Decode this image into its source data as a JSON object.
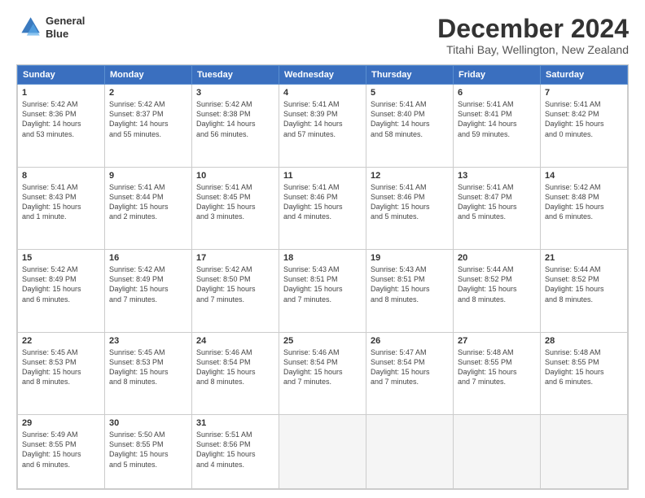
{
  "logo": {
    "line1": "General",
    "line2": "Blue"
  },
  "title": "December 2024",
  "subtitle": "Titahi Bay, Wellington, New Zealand",
  "days_of_week": [
    "Sunday",
    "Monday",
    "Tuesday",
    "Wednesday",
    "Thursday",
    "Friday",
    "Saturday"
  ],
  "weeks": [
    [
      {
        "day": "1",
        "info": "Sunrise: 5:42 AM\nSunset: 8:36 PM\nDaylight: 14 hours\nand 53 minutes."
      },
      {
        "day": "2",
        "info": "Sunrise: 5:42 AM\nSunset: 8:37 PM\nDaylight: 14 hours\nand 55 minutes."
      },
      {
        "day": "3",
        "info": "Sunrise: 5:42 AM\nSunset: 8:38 PM\nDaylight: 14 hours\nand 56 minutes."
      },
      {
        "day": "4",
        "info": "Sunrise: 5:41 AM\nSunset: 8:39 PM\nDaylight: 14 hours\nand 57 minutes."
      },
      {
        "day": "5",
        "info": "Sunrise: 5:41 AM\nSunset: 8:40 PM\nDaylight: 14 hours\nand 58 minutes."
      },
      {
        "day": "6",
        "info": "Sunrise: 5:41 AM\nSunset: 8:41 PM\nDaylight: 14 hours\nand 59 minutes."
      },
      {
        "day": "7",
        "info": "Sunrise: 5:41 AM\nSunset: 8:42 PM\nDaylight: 15 hours\nand 0 minutes."
      }
    ],
    [
      {
        "day": "8",
        "info": "Sunrise: 5:41 AM\nSunset: 8:43 PM\nDaylight: 15 hours\nand 1 minute."
      },
      {
        "day": "9",
        "info": "Sunrise: 5:41 AM\nSunset: 8:44 PM\nDaylight: 15 hours\nand 2 minutes."
      },
      {
        "day": "10",
        "info": "Sunrise: 5:41 AM\nSunset: 8:45 PM\nDaylight: 15 hours\nand 3 minutes."
      },
      {
        "day": "11",
        "info": "Sunrise: 5:41 AM\nSunset: 8:46 PM\nDaylight: 15 hours\nand 4 minutes."
      },
      {
        "day": "12",
        "info": "Sunrise: 5:41 AM\nSunset: 8:46 PM\nDaylight: 15 hours\nand 5 minutes."
      },
      {
        "day": "13",
        "info": "Sunrise: 5:41 AM\nSunset: 8:47 PM\nDaylight: 15 hours\nand 5 minutes."
      },
      {
        "day": "14",
        "info": "Sunrise: 5:42 AM\nSunset: 8:48 PM\nDaylight: 15 hours\nand 6 minutes."
      }
    ],
    [
      {
        "day": "15",
        "info": "Sunrise: 5:42 AM\nSunset: 8:49 PM\nDaylight: 15 hours\nand 6 minutes."
      },
      {
        "day": "16",
        "info": "Sunrise: 5:42 AM\nSunset: 8:49 PM\nDaylight: 15 hours\nand 7 minutes."
      },
      {
        "day": "17",
        "info": "Sunrise: 5:42 AM\nSunset: 8:50 PM\nDaylight: 15 hours\nand 7 minutes."
      },
      {
        "day": "18",
        "info": "Sunrise: 5:43 AM\nSunset: 8:51 PM\nDaylight: 15 hours\nand 7 minutes."
      },
      {
        "day": "19",
        "info": "Sunrise: 5:43 AM\nSunset: 8:51 PM\nDaylight: 15 hours\nand 8 minutes."
      },
      {
        "day": "20",
        "info": "Sunrise: 5:44 AM\nSunset: 8:52 PM\nDaylight: 15 hours\nand 8 minutes."
      },
      {
        "day": "21",
        "info": "Sunrise: 5:44 AM\nSunset: 8:52 PM\nDaylight: 15 hours\nand 8 minutes."
      }
    ],
    [
      {
        "day": "22",
        "info": "Sunrise: 5:45 AM\nSunset: 8:53 PM\nDaylight: 15 hours\nand 8 minutes."
      },
      {
        "day": "23",
        "info": "Sunrise: 5:45 AM\nSunset: 8:53 PM\nDaylight: 15 hours\nand 8 minutes."
      },
      {
        "day": "24",
        "info": "Sunrise: 5:46 AM\nSunset: 8:54 PM\nDaylight: 15 hours\nand 8 minutes."
      },
      {
        "day": "25",
        "info": "Sunrise: 5:46 AM\nSunset: 8:54 PM\nDaylight: 15 hours\nand 7 minutes."
      },
      {
        "day": "26",
        "info": "Sunrise: 5:47 AM\nSunset: 8:54 PM\nDaylight: 15 hours\nand 7 minutes."
      },
      {
        "day": "27",
        "info": "Sunrise: 5:48 AM\nSunset: 8:55 PM\nDaylight: 15 hours\nand 7 minutes."
      },
      {
        "day": "28",
        "info": "Sunrise: 5:48 AM\nSunset: 8:55 PM\nDaylight: 15 hours\nand 6 minutes."
      }
    ],
    [
      {
        "day": "29",
        "info": "Sunrise: 5:49 AM\nSunset: 8:55 PM\nDaylight: 15 hours\nand 6 minutes."
      },
      {
        "day": "30",
        "info": "Sunrise: 5:50 AM\nSunset: 8:55 PM\nDaylight: 15 hours\nand 5 minutes."
      },
      {
        "day": "31",
        "info": "Sunrise: 5:51 AM\nSunset: 8:56 PM\nDaylight: 15 hours\nand 4 minutes."
      },
      {
        "day": "",
        "info": ""
      },
      {
        "day": "",
        "info": ""
      },
      {
        "day": "",
        "info": ""
      },
      {
        "day": "",
        "info": ""
      }
    ]
  ]
}
